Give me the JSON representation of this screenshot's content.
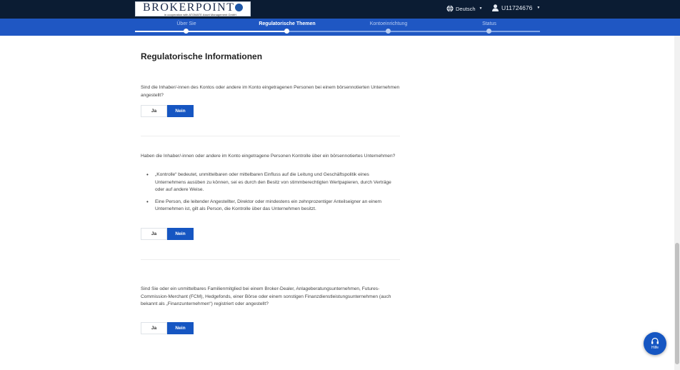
{
  "header": {
    "logo_text": "BROKERPOINT",
    "logo_subtitle": "in cooperation with ATOMATE Asset Management GmbH",
    "language": "Deutsch",
    "user_id": "U11724676",
    "colors": {
      "navbar": "#0b1c33",
      "stepbar": "#1f57c3",
      "accent": "#1656c2"
    }
  },
  "steps": [
    {
      "label": "Über Sie",
      "state": "done"
    },
    {
      "label": "Regulatorische Themen",
      "state": "active"
    },
    {
      "label": "Kontoeinrichtung",
      "state": "pending"
    },
    {
      "label": "Status",
      "state": "pending"
    }
  ],
  "main": {
    "title": "Regulatorische Informationen",
    "questions": [
      {
        "text": "Sind die Inhaber/-innen des Kontos oder andere im Konto eingetragenen Personen bei einem börsennotierten Unternehmen angestellt?",
        "yes_label": "Ja",
        "no_label": "Nein",
        "selected": "Nein"
      },
      {
        "text": "Haben die Inhaber/-innen oder andere im Konto eingetragene Personen Kontrolle über ein börsennotiertes Unternehmen?",
        "bullets": [
          "„Kontrolle“ bedeutet, unmittelbaren oder mittelbaren Einfluss auf die Leitung und Geschäftspolitik eines Unternehmens ausüben zu können, sei es durch den Besitz von stimmberechtigten Wertpapieren, durch Verträge oder auf andere Weise.",
          "Eine Person, die leitender Angestellter, Direktor oder mindestens ein zehnprozentiger Anteilseigner an einem Unternehmen ist, gilt als Person, die Kontrolle über das Unternehmen besitzt."
        ],
        "yes_label": "Ja",
        "no_label": "Nein",
        "selected": "Nein"
      },
      {
        "text": "Sind Sie oder ein unmittelbares Familienmitglied bei einem Broker-Dealer, Anlageberatungsunternehmen, Futures-Commission-Merchant (FCM), Hedgefonds, einer Börse oder einem sonstigen Finanzdienstleistungsunternehmen (auch bekannt als „Finanzunternehmen“) registriert oder angestellt?",
        "yes_label": "Ja",
        "no_label": "Nein",
        "selected": "Nein"
      }
    ]
  },
  "help": {
    "label": "Hilfe",
    "icon": "headset-icon"
  }
}
